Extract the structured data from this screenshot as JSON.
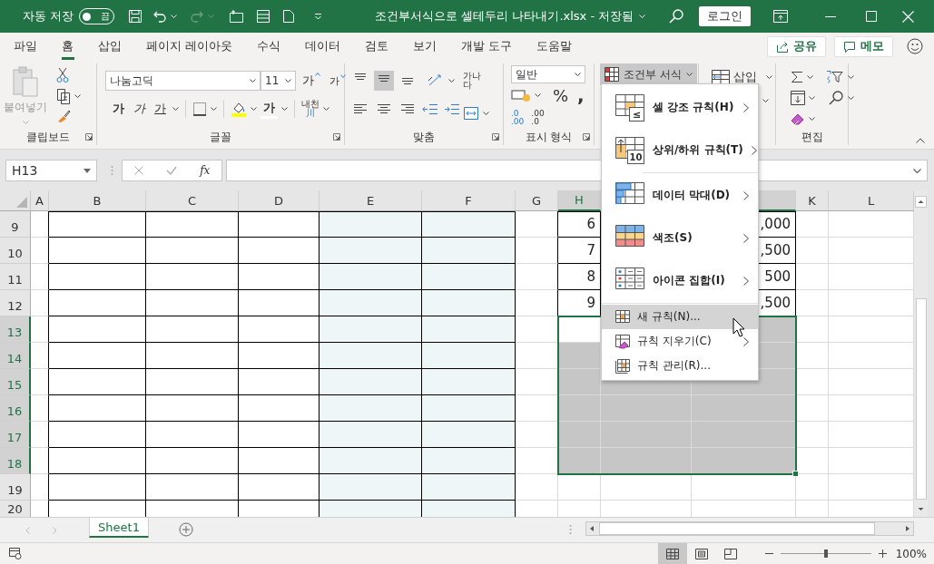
{
  "window": {
    "autosave_label": "자동 저장",
    "autosave_on": false,
    "autosave_state": "끔",
    "title": "조건부서식으로 셀테두리 나타내기.xlsx - 저장됨",
    "login": "로그인"
  },
  "menu_tabs": [
    {
      "label": "파일",
      "selected": false
    },
    {
      "label": "홈",
      "selected": true
    },
    {
      "label": "삽입",
      "selected": false
    },
    {
      "label": "페이지 레이아웃",
      "selected": false
    },
    {
      "label": "수식",
      "selected": false
    },
    {
      "label": "데이터",
      "selected": false
    },
    {
      "label": "검토",
      "selected": false
    },
    {
      "label": "보기",
      "selected": false
    },
    {
      "label": "개발 도구",
      "selected": false
    },
    {
      "label": "도움말",
      "selected": false
    }
  ],
  "share": {
    "label": "공유"
  },
  "comments": {
    "label": "메모"
  },
  "ribbon": {
    "groups": [
      {
        "kind": "clipboard",
        "label": "클립보드",
        "launcher": true,
        "paste": "붙여넣기"
      },
      {
        "kind": "font",
        "label": "글꼴",
        "launcher": true,
        "font_name": "나눔고딕",
        "font_size": "11",
        "grow": "가",
        "shrink": "가",
        "bold": "가",
        "italic": "가",
        "underline": "가",
        "font_color": "가",
        "phonetic": "내천",
        "phonetic_sub": "川"
      },
      {
        "kind": "alignment",
        "label": "맞춤",
        "launcher": true,
        "vertical_aligns": [
          {
            "selected": false
          },
          {
            "selected": true
          },
          {
            "selected": false
          }
        ],
        "wrap": "가나",
        "wrap_sub": "다"
      },
      {
        "kind": "number",
        "label": "표시 형식",
        "launcher": true,
        "format": "일반",
        "percent": "%",
        "comma": ",",
        "decimal_increase": [
          ".0",
          ".00"
        ],
        "decimal_decrease": [
          ".00",
          ".0"
        ]
      },
      {
        "kind": "styles",
        "conditional": "조건부 서식",
        "expanded": true
      },
      {
        "kind": "cells",
        "insert": "삽입"
      },
      {
        "kind": "editing",
        "label": "편집"
      }
    ]
  },
  "formula_bar": {
    "name_box": "H13",
    "function_label": "fx"
  },
  "sheet": {
    "columns": [
      {
        "label": "A",
        "selected": false
      },
      {
        "label": "B",
        "selected": false
      },
      {
        "label": "C",
        "selected": false
      },
      {
        "label": "D",
        "selected": false
      },
      {
        "label": "E",
        "selected": false,
        "shaded": true
      },
      {
        "label": "F",
        "selected": false,
        "shaded": true
      },
      {
        "label": "G",
        "selected": false
      },
      {
        "label": "H",
        "selected": true
      },
      {
        "selected": true
      },
      {
        "selected": true
      },
      {
        "label": "K",
        "selected": false
      },
      {
        "label": "L",
        "selected": false
      }
    ],
    "rows": [
      {
        "label": "9",
        "selected": false,
        "cells": [
          null,
          {
            "bordered": true
          },
          {
            "bordered": true
          },
          {
            "bordered": true
          },
          {
            "bordered": true
          },
          {
            "bordered": true
          },
          null,
          {
            "bordered": true,
            "text": "6"
          },
          null,
          {
            "bordered": true,
            "text": ",000"
          },
          null,
          null
        ]
      },
      {
        "label": "10",
        "selected": false,
        "cells": [
          null,
          {
            "bordered": true
          },
          {
            "bordered": true
          },
          {
            "bordered": true
          },
          {
            "bordered": true
          },
          {
            "bordered": true
          },
          null,
          {
            "bordered": true,
            "text": "7"
          },
          null,
          {
            "bordered": true,
            "text": ",500"
          },
          null,
          null
        ]
      },
      {
        "label": "11",
        "selected": false,
        "cells": [
          null,
          {
            "bordered": true
          },
          {
            "bordered": true
          },
          {
            "bordered": true
          },
          {
            "bordered": true
          },
          {
            "bordered": true
          },
          null,
          {
            "bordered": true,
            "text": "8"
          },
          null,
          {
            "bordered": true,
            "text": "500"
          },
          null,
          null
        ]
      },
      {
        "label": "12",
        "selected": false,
        "cells": [
          null,
          {
            "bordered": true
          },
          {
            "bordered": true
          },
          {
            "bordered": true
          },
          {
            "bordered": true
          },
          {
            "bordered": true
          },
          null,
          {
            "bordered": true,
            "text": "9"
          },
          null,
          {
            "bordered": true,
            "text": ",500"
          },
          null,
          null
        ]
      },
      {
        "label": "13",
        "selected": true,
        "cells": [
          null,
          {
            "bordered": true
          },
          {
            "bordered": true
          },
          {
            "bordered": true
          },
          {
            "bordered": true
          },
          {
            "bordered": true
          },
          null,
          null,
          null,
          null,
          null,
          null
        ]
      },
      {
        "label": "14",
        "selected": true,
        "cells": [
          null,
          {
            "bordered": true
          },
          {
            "bordered": true
          },
          {
            "bordered": true
          },
          {
            "bordered": true
          },
          {
            "bordered": true
          },
          null,
          null,
          null,
          null,
          null,
          null
        ]
      },
      {
        "label": "15",
        "selected": true,
        "cells": [
          null,
          {
            "bordered": true
          },
          {
            "bordered": true
          },
          {
            "bordered": true
          },
          {
            "bordered": true
          },
          {
            "bordered": true
          },
          null,
          null,
          null,
          null,
          null,
          null
        ]
      },
      {
        "label": "16",
        "selected": true,
        "cells": [
          null,
          {
            "bordered": true
          },
          {
            "bordered": true
          },
          {
            "bordered": true
          },
          {
            "bordered": true
          },
          {
            "bordered": true
          },
          null,
          null,
          null,
          null,
          null,
          null
        ]
      },
      {
        "label": "17",
        "selected": true,
        "cells": [
          null,
          {
            "bordered": true
          },
          {
            "bordered": true
          },
          {
            "bordered": true
          },
          {
            "bordered": true
          },
          {
            "bordered": true
          },
          null,
          null,
          null,
          null,
          null,
          null
        ]
      },
      {
        "label": "18",
        "selected": true,
        "cells": [
          null,
          {
            "bordered": true
          },
          {
            "bordered": true
          },
          {
            "bordered": true
          },
          {
            "bordered": true
          },
          {
            "bordered": true
          },
          null,
          null,
          null,
          null,
          null,
          null
        ]
      },
      {
        "label": "19",
        "selected": false,
        "cells": [
          null,
          {
            "bordered": true
          },
          {
            "bordered": true
          },
          {
            "bordered": true
          },
          {
            "bordered": true
          },
          {
            "bordered": true
          },
          null,
          null,
          null,
          null,
          null,
          null
        ]
      },
      {
        "label": "20",
        "selected": false,
        "cells": [
          null,
          {
            "bordered": true
          },
          {
            "bordered": true
          },
          {
            "bordered": true
          },
          {
            "bordered": true
          },
          {
            "bordered": true
          },
          null,
          null,
          null,
          null,
          null,
          null
        ]
      }
    ]
  },
  "conditional_menu": {
    "groups": [
      {
        "items": [
          {
            "label": "셀 강조 규칙(H)",
            "kind": "large",
            "icon_text": "≤",
            "submenu": true,
            "selected": false
          },
          {
            "label": "상위/하위 규칙(T)",
            "kind": "large",
            "icon_text": "10",
            "submenu": true,
            "selected": false
          }
        ]
      },
      {
        "items": [
          {
            "label": "데이터 막대(D)",
            "kind": "large",
            "submenu": true,
            "selected": false
          },
          {
            "label": "색조(S)",
            "kind": "large",
            "submenu": true,
            "selected": false
          },
          {
            "label": "아이콘 집합(I)",
            "kind": "large",
            "submenu": true,
            "selected": false
          }
        ]
      },
      {
        "items": [
          {
            "label": "새 규칙(N)...",
            "kind": "small",
            "submenu": false,
            "selected": true
          },
          {
            "label": "규칙 지우기(C)",
            "kind": "small",
            "submenu": true,
            "selected": false
          },
          {
            "label": "규칙 관리(R)...",
            "kind": "small",
            "submenu": false,
            "selected": false
          }
        ]
      }
    ]
  },
  "sheet_tabs": [
    {
      "label": "Sheet1",
      "selected": true
    }
  ],
  "status_bar": {
    "views": [
      {
        "kind": "normal",
        "selected": true
      },
      {
        "kind": "page_layout",
        "selected": false
      },
      {
        "kind": "page_break",
        "selected": false
      }
    ],
    "zoom": {
      "level": 0.5,
      "reading": "100%"
    }
  }
}
